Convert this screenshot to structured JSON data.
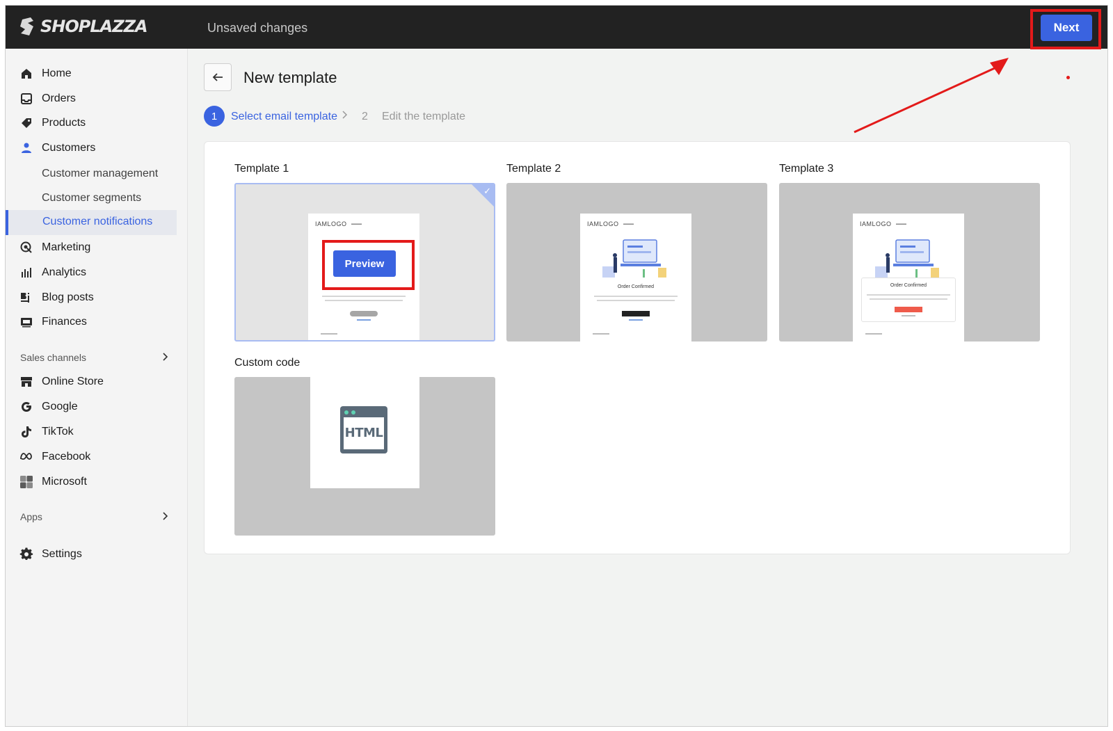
{
  "brand": {
    "name": "SHOPLAZZA"
  },
  "header": {
    "status_text": "Unsaved changes",
    "next_label": "Next"
  },
  "sidebar": {
    "items": [
      {
        "label": "Home",
        "icon": "home-icon"
      },
      {
        "label": "Orders",
        "icon": "inbox-icon"
      },
      {
        "label": "Products",
        "icon": "tag-icon"
      },
      {
        "label": "Customers",
        "icon": "user-icon"
      }
    ],
    "customer_sub": [
      "Customer management",
      "Customer segments",
      "Customer notifications"
    ],
    "items2": [
      {
        "label": "Marketing",
        "icon": "target-icon"
      },
      {
        "label": "Analytics",
        "icon": "bar-chart-icon"
      },
      {
        "label": "Blog posts",
        "icon": "blog-icon"
      },
      {
        "label": "Finances",
        "icon": "wallet-icon"
      }
    ],
    "sales_channels_label": "Sales channels",
    "channels": [
      {
        "label": "Online Store",
        "icon": "store-icon"
      },
      {
        "label": "Google",
        "icon": "google-icon"
      },
      {
        "label": "TikTok",
        "icon": "tiktok-icon"
      },
      {
        "label": "Facebook",
        "icon": "meta-icon"
      },
      {
        "label": "Microsoft",
        "icon": "microsoft-icon"
      }
    ],
    "apps_label": "Apps",
    "settings_label": "Settings"
  },
  "page": {
    "title": "New template",
    "steps": [
      {
        "num": "1",
        "label": "Select email template"
      },
      {
        "num": "2",
        "label": "Edit the template"
      }
    ]
  },
  "templates": [
    {
      "label": "Template 1",
      "logo": "IAMLOGO",
      "preview_label": "Preview"
    },
    {
      "label": "Template 2",
      "logo": "IAMLOGO",
      "heading": "Order Confirmed"
    },
    {
      "label": "Template 3",
      "logo": "IAMLOGO",
      "heading": "Order Confirmed"
    }
  ],
  "custom_code": {
    "label": "Custom code",
    "icon_text": "HTML"
  },
  "colors": {
    "accent": "#3a63e0",
    "highlight": "#e31a1a",
    "topbar": "#222222"
  }
}
